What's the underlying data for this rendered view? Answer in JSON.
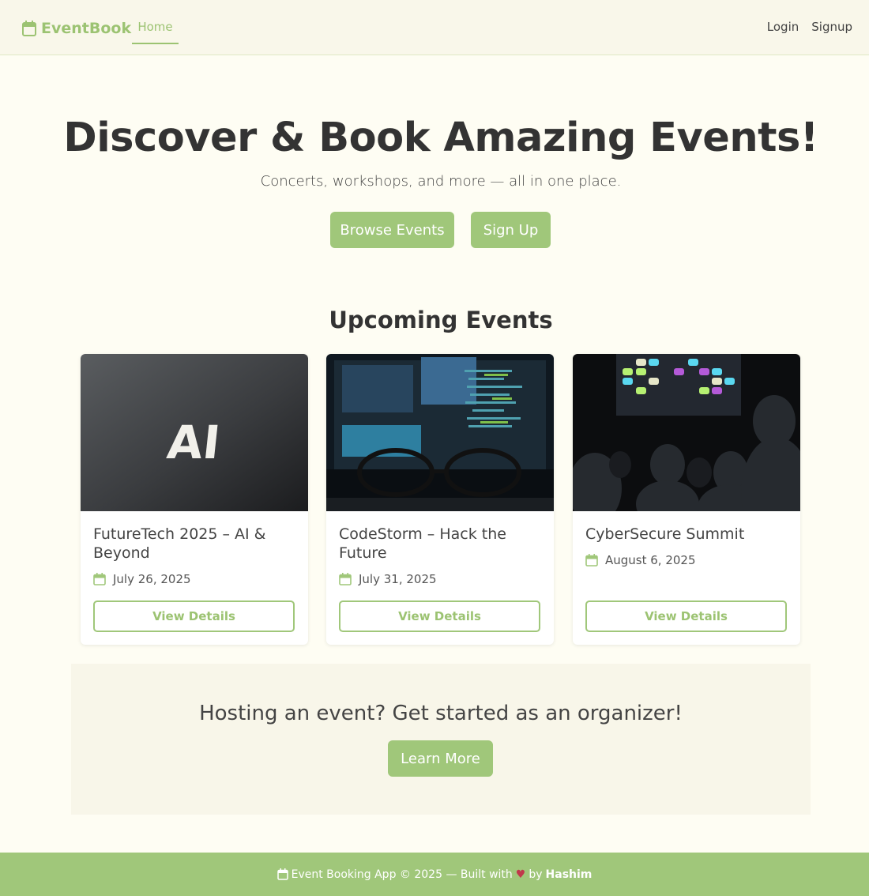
{
  "nav": {
    "brand": "EventBook",
    "home": "Home",
    "login": "Login",
    "signup": "Signup"
  },
  "hero": {
    "title": "Discover & Book Amazing Events!",
    "subtitle": "Concerts, workshops, and more — all in one place.",
    "browse_button": "Browse Events",
    "signup_button": "Sign Up"
  },
  "events": {
    "heading": "Upcoming Events",
    "items": [
      {
        "title": "FutureTech 2025 – AI & Beyond",
        "date": "July 26, 2025",
        "button": "View Details"
      },
      {
        "title": "CodeStorm – Hack the Future",
        "date": "July 31, 2025",
        "button": "View Details"
      },
      {
        "title": "CyberSecure Summit",
        "date": "August 6, 2025",
        "button": "View Details"
      }
    ]
  },
  "cta": {
    "title": "Hosting an event? Get started as an organizer!",
    "button": "Learn More"
  },
  "footer": {
    "text_before": "Event Booking App © 2025 — Built with",
    "heart": "♥",
    "by": "by",
    "author": "Hashim"
  },
  "colors": {
    "accent": "#a0c77a",
    "background": "#fefdf3",
    "navbar": "#f9f7ea"
  }
}
